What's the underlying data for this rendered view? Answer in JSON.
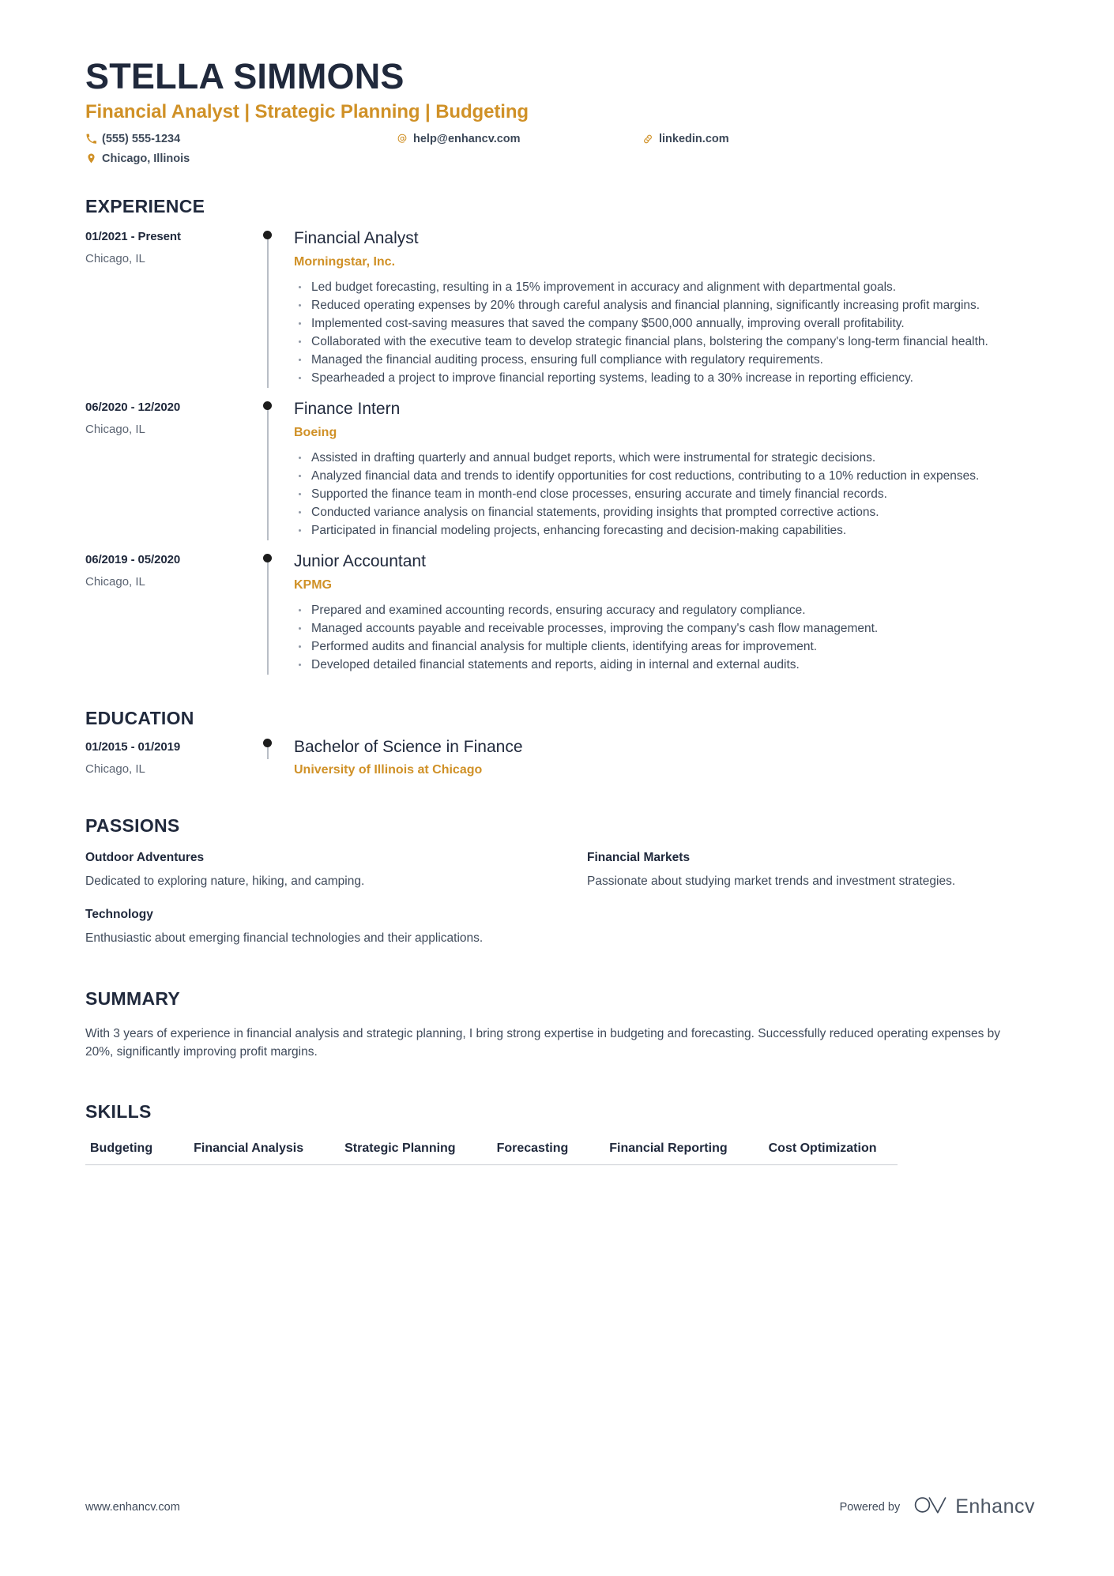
{
  "header": {
    "name": "STELLA SIMMONS",
    "headline": "Financial Analyst | Strategic Planning | Budgeting",
    "contacts": {
      "phone": "(555) 555-1234",
      "email": "help@enhancv.com",
      "website": "linkedin.com",
      "location": "Chicago, Illinois"
    },
    "icons": {
      "phone": "phone-icon",
      "email": "at-sign-icon",
      "link": "link-icon",
      "location": "map-pin-icon"
    }
  },
  "colors": {
    "accent": "#d09127",
    "heading": "#20293c",
    "body": "#3f4a5a",
    "rule": "#c9ccd2",
    "timeline": "#b9bec6",
    "dot": "#1c1c1c"
  },
  "sections": {
    "experience": {
      "title": "EXPERIENCE",
      "entries": [
        {
          "date": "01/2021 - Present",
          "location": "Chicago, IL",
          "role": "Financial Analyst",
          "company": "Morningstar, Inc.",
          "bullets": [
            "Led budget forecasting, resulting in a 15% improvement in accuracy and alignment with departmental goals.",
            "Reduced operating expenses by 20% through careful analysis and financial planning, significantly increasing profit margins.",
            "Implemented cost-saving measures that saved the company $500,000 annually, improving overall profitability.",
            "Collaborated with the executive team to develop strategic financial plans, bolstering the company's long-term financial health.",
            "Managed the financial auditing process, ensuring full compliance with regulatory requirements.",
            "Spearheaded a project to improve financial reporting systems, leading to a 30% increase in reporting efficiency."
          ]
        },
        {
          "date": "06/2020 - 12/2020",
          "location": "Chicago, IL",
          "role": "Finance Intern",
          "company": "Boeing",
          "bullets": [
            "Assisted in drafting quarterly and annual budget reports, which were instrumental for strategic decisions.",
            "Analyzed financial data and trends to identify opportunities for cost reductions, contributing to a 10% reduction in expenses.",
            "Supported the finance team in month-end close processes, ensuring accurate and timely financial records.",
            "Conducted variance analysis on financial statements, providing insights that prompted corrective actions.",
            "Participated in financial modeling projects, enhancing forecasting and decision-making capabilities."
          ]
        },
        {
          "date": "06/2019 - 05/2020",
          "location": "Chicago, IL",
          "role": "Junior Accountant",
          "company": "KPMG",
          "bullets": [
            "Prepared and examined accounting records, ensuring accuracy and regulatory compliance.",
            "Managed accounts payable and receivable processes, improving the company's cash flow management.",
            "Performed audits and financial analysis for multiple clients, identifying areas for improvement.",
            "Developed detailed financial statements and reports, aiding in internal and external audits."
          ]
        }
      ]
    },
    "education": {
      "title": "EDUCATION",
      "entries": [
        {
          "date": "01/2015 - 01/2019",
          "location": "Chicago, IL",
          "degree": "Bachelor of Science in Finance",
          "school": "University of Illinois at Chicago"
        }
      ]
    },
    "passions": {
      "title": "PASSIONS",
      "items": [
        {
          "title": "Outdoor Adventures",
          "description": "Dedicated to exploring nature, hiking, and camping."
        },
        {
          "title": "Financial Markets",
          "description": "Passionate about studying market trends and investment strategies."
        },
        {
          "title": "Technology",
          "description": "Enthusiastic about emerging financial technologies and their applications."
        }
      ]
    },
    "summary": {
      "title": "SUMMARY",
      "text": "With 3 years of experience in financial analysis and strategic planning, I bring strong expertise in budgeting and forecasting. Successfully reduced operating expenses by 20%, significantly improving profit margins."
    },
    "skills": {
      "title": "SKILLS",
      "items": [
        "Budgeting",
        "Financial Analysis",
        "Strategic Planning",
        "Forecasting",
        "Financial Reporting",
        "Cost Optimization"
      ]
    }
  },
  "footer": {
    "url": "www.enhancv.com",
    "powered_by_label": "Powered by",
    "brand_name": "Enhancv",
    "brand_logo_icon": "enhancv-infinity-icon"
  }
}
